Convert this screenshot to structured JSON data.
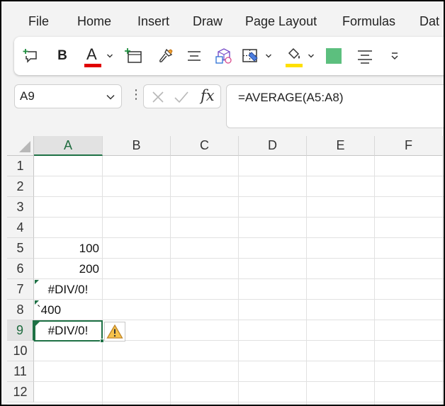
{
  "menu": {
    "items": [
      "File",
      "Home",
      "Insert",
      "Draw",
      "Page Layout",
      "Formulas",
      "Dat"
    ]
  },
  "ribbon": {
    "bold_label": "B",
    "font_color_label": "A",
    "font_color": "#e00000",
    "highlight_color": "#ffe000",
    "fill_swatch_color": "#5cbf7e",
    "icons": [
      "new-comment-icon",
      "bold-icon",
      "font-color-icon",
      "insert-sheet-icon",
      "format-painter-icon",
      "align-icon",
      "3d-shapes-icon",
      "borders-icon",
      "fill-color-icon",
      "fill-swatch-icon",
      "center-align-icon",
      "overflow-icon"
    ]
  },
  "formula_bar": {
    "name_box": "A9",
    "dots": "⋮",
    "fx_label": "fx",
    "formula": "=AVERAGE(A5:A8)"
  },
  "grid": {
    "columns": [
      "A",
      "B",
      "C",
      "D",
      "E",
      "F"
    ],
    "selected_column": "A",
    "rows": [
      "1",
      "2",
      "3",
      "4",
      "5",
      "6",
      "7",
      "8",
      "9",
      "10",
      "11",
      "12"
    ],
    "selected_row": "9",
    "cells": {
      "A5": "100",
      "A6": "200",
      "A7": "#DIV/0!",
      "A8": "`400",
      "A9": "#DIV/0!"
    },
    "accent_color": "#1e7145",
    "warning_icon": "warning-icon"
  }
}
